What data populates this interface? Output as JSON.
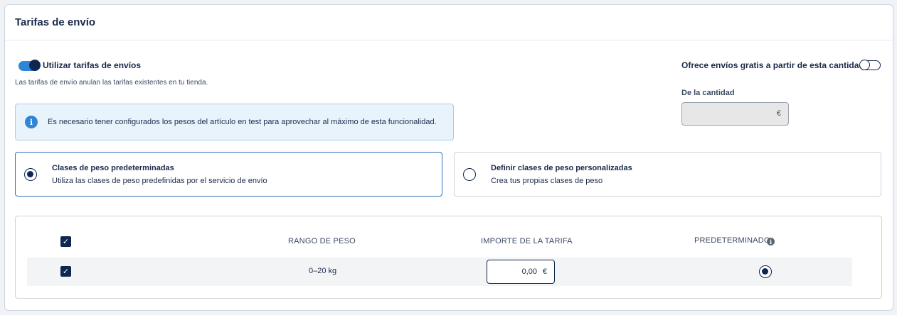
{
  "card": {
    "title": "Tarifas de envío"
  },
  "use_rates": {
    "label": "Utilizar tarifas de envíos",
    "enabled": true,
    "help": "Las tarifas de envío anulan las tarifas existentes en tu tienda."
  },
  "free_shipping": {
    "label": "Ofrece envíos gratis a partir de esta cantidad",
    "enabled": false,
    "amount_label": "De la cantidad",
    "amount_value": "",
    "currency": "€"
  },
  "info": {
    "icon": "i",
    "text": "Es necesario tener configurados los pesos del artículo en test para aprovechar al máximo de esta funcionalidad."
  },
  "options": [
    {
      "title": "Clases de peso predeterminadas",
      "description": "Utiliza las clases de peso predefinidas por el servicio de envío",
      "selected": true
    },
    {
      "title": "Definir clases de peso personalizadas",
      "description": "Crea tus propias clases de peso",
      "selected": false
    }
  ],
  "table": {
    "headers": {
      "weight_range": "RANGO DE PESO",
      "rate_amount": "IMPORTE DE LA TARIFA",
      "default": "PREDETERMINADO"
    },
    "header_checked": true,
    "rows": [
      {
        "checked": true,
        "weight_range": "0–20 kg",
        "rate": "0,00",
        "currency": "€",
        "default": true
      }
    ]
  },
  "icons": {
    "check": "✓",
    "info": "i"
  },
  "colors": {
    "accent": "#2f86d6",
    "primary": "#0f2650"
  }
}
